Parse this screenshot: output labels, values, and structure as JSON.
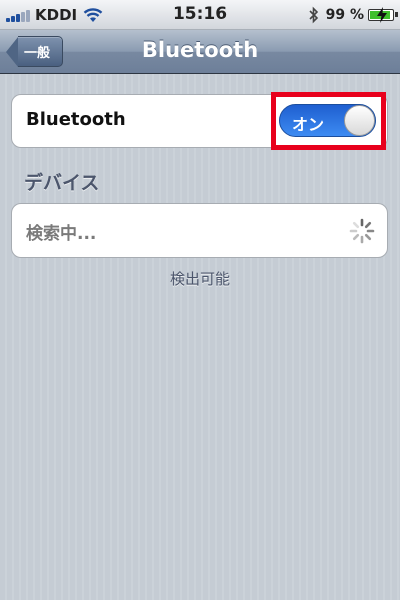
{
  "status_bar": {
    "carrier": "KDDI",
    "time": "15:16",
    "battery_percent": "99 %",
    "signal_bars_active": 3,
    "icons": [
      "signal-icon",
      "wifi-icon",
      "bluetooth-icon",
      "battery-charging-icon"
    ]
  },
  "nav_bar": {
    "back_label": "一般",
    "title": "Bluetooth"
  },
  "bluetooth_cell": {
    "label": "Bluetooth",
    "toggle_label": "オン",
    "toggle_state": "on"
  },
  "devices_section": {
    "header": "デバイス",
    "searching_label": "検索中...",
    "spinner_icon": "spinner-icon",
    "footer": "検出可能"
  },
  "colors": {
    "toggle_on": "#2f78e0",
    "highlight": "#e8001c",
    "nav_bar": "#7889a1"
  }
}
